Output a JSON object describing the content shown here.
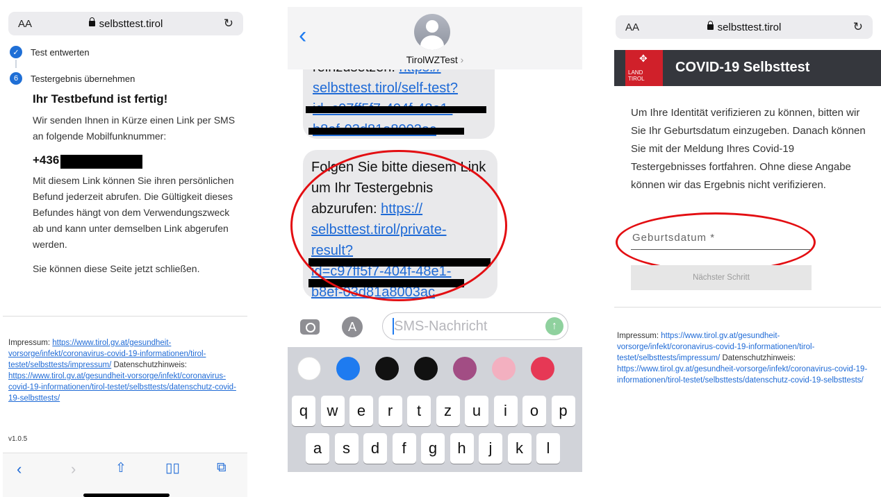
{
  "panel1": {
    "url": {
      "aa": "AA",
      "domain": "selbsttest.tirol"
    },
    "steps": {
      "step5_label": "Test entwerten",
      "step6_num": "6",
      "step6_label": "Testergebnis übernehmen"
    },
    "title": "Ihr Testbefund ist fertig!",
    "intro": "Wir senden Ihnen in Kürze einen Link per SMS an folgende Mobilfunknummer:",
    "phone_prefix": "+436",
    "body1": "Mit diesem Link können Sie ihren persönlichen Befund jederzeit abrufen. Die Gültigkeit dieses Befundes hängt von dem Verwendungszweck ab und kann unter demselben Link abgerufen werden.",
    "body2": "Sie können diese Seite jetzt schließen.",
    "footer": {
      "impressum_label": "Impressum: ",
      "impressum_url": "https://www.tirol.gv.at/gesundheit-vorsorge/infekt/coronavirus-covid-19-informationen/tirol-testet/selbsttests/impressum/",
      "datenschutz_label": "Datenschutzhinweis: ",
      "datenschutz_url": "https://www.tirol.gv.at/gesundheit-vorsorge/infekt/coronavirus-covid-19-informationen/tirol-testet/selbsttests/datenschutz-covid-19-selbsttests/",
      "version": "v1.0.5"
    }
  },
  "panel2": {
    "contact": "TirolWZTest",
    "bubble1": {
      "prefix": "reinzusetzen: ",
      "link1": "https://",
      "link2": "selbsttest.tirol/self-test?",
      "link3": "id=c97ff5f7-404f-48e1-",
      "link4": "b8ef-03d81a8003ac"
    },
    "bubble2": {
      "text": "Folgen Sie bitte diesem Link um Ihr Testergebnis abzurufen: ",
      "link1": "https://",
      "link2": "selbsttest.tirol/private-",
      "link3": "result?",
      "link4": "id=c97ff5f7-404f-48e1-",
      "link5": "b8ef-03d81a8003ac"
    },
    "sms_placeholder": "SMS-Nachricht",
    "keyboard_row1": [
      "q",
      "w",
      "e",
      "r",
      "t",
      "z",
      "u",
      "i",
      "o",
      "p"
    ],
    "keyboard_row2": [
      "a",
      "s",
      "d",
      "f",
      "g",
      "h",
      "j",
      "k",
      "l"
    ]
  },
  "panel3": {
    "url": {
      "aa": "AA",
      "domain": "selbsttest.tirol"
    },
    "logo": {
      "line1": "LAND",
      "line2": "TIROL"
    },
    "title": "COVID-19 Selbsttest",
    "text": "Um Ihre Identität verifizieren zu können, bitten wir Sie Ihr Geburtsdatum einzugeben. Danach können Sie mit der Meldung Ihres Covid-19 Testergebnisses fortfahren. Ohne diese Angabe können wir das Ergebnis nicht verifizieren.",
    "birth_placeholder": "Geburtsdatum *",
    "next_button": "Nächster Schritt",
    "footer": {
      "impressum_label": "Impressum: ",
      "impressum_url": "https://www.tirol.gv.at/gesundheit-vorsorge/infekt/coronavirus-covid-19-informationen/tirol-testet/selbsttests/impressum/",
      "datenschutz_label": "Datenschutzhinweis: ",
      "datenschutz_url": "https://www.tirol.gv.at/gesundheit-vorsorge/infekt/coronavirus-covid-19-informationen/tirol-testet/selbsttests/datenschutz-covid-19-selbsttests/"
    }
  },
  "colors": {
    "link": "#1e6ad6",
    "imessage_blue": "#1e7bf0",
    "annotation_red": "#e30e12",
    "tirol_red": "#d0202a",
    "header_dark": "#35373d"
  }
}
